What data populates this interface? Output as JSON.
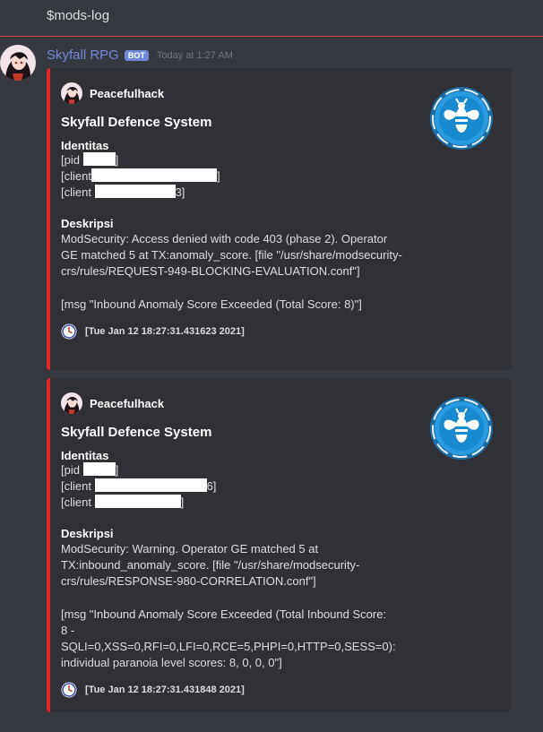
{
  "previous_message": "$mods-log",
  "message": {
    "username": "Skyfall RPG",
    "bot_tag": "BOT",
    "timestamp": "Today at 1:27 AM"
  },
  "embeds": [
    {
      "author": "Peacefulhack",
      "title": "Skyfall Defence System",
      "identity_label": "Identitas",
      "identity_lines": [
        {
          "pre": "[pid ",
          "post": "]"
        },
        {
          "pre": "[client",
          "post": "]"
        },
        {
          "pre": "[client ",
          "post": "3]"
        }
      ],
      "description_label": "Deskripsi",
      "description": "ModSecurity: Access denied with code 403 (phase 2). Operator GE matched 5 at TX:anomaly_score. [file \"/usr/share/modsecurity-crs/rules/REQUEST-949-BLOCKING-EVALUATION.conf\"]",
      "msg": "[msg \"Inbound Anomaly Score Exceeded (Total Score: 8)\"]",
      "footer": "[Tue Jan 12 18:27:31.431623 2021]"
    },
    {
      "author": "Peacefulhack",
      "title": "Skyfall Defence System",
      "identity_label": "Identitas",
      "identity_lines": [
        {
          "pre": "[pid ",
          "post": "]"
        },
        {
          "pre": "[client ",
          "post": "6]"
        },
        {
          "pre": "[client ",
          "post": "]"
        }
      ],
      "description_label": "Deskripsi",
      "description": "ModSecurity: Warning. Operator GE matched 5 at TX:inbound_anomaly_score. [file \"/usr/share/modsecurity-crs/rules/RESPONSE-980-CORRELATION.conf\"]",
      "msg": "[msg \"Inbound Anomaly Score Exceeded (Total Inbound Score: 8 - SQLI=0,XSS=0,RFI=0,LFI=0,RCE=5,PHPI=0,HTTP=0,SESS=0): individual paranoia level scores: 8, 0, 0, 0\"]",
      "footer": "[Tue Jan 12 18:27:31.431848 2021]"
    }
  ],
  "colors": {
    "accent": "#e3262b",
    "username": "#7289da",
    "embed_bg": "#2f3136",
    "bg": "#36393f"
  },
  "icons": [
    "bot-avatar",
    "author-avatar",
    "bee-shield-thumbnail",
    "clock-icon"
  ]
}
